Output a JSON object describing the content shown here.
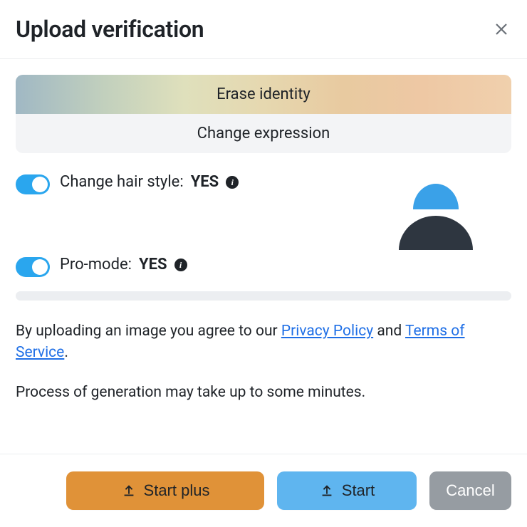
{
  "header": {
    "title": "Upload verification"
  },
  "tabs": {
    "erase": "Erase identity",
    "change": "Change expression"
  },
  "options": {
    "hair": {
      "label": "Change hair style:",
      "value": "YES"
    },
    "pro": {
      "label": "Pro-mode:",
      "value": "YES"
    }
  },
  "legal": {
    "prefix": "By uploading an image you agree to our ",
    "privacy": "Privacy Policy",
    "mid": " and ",
    "terms": "Terms of Service",
    "suffix": "."
  },
  "note": "Process of generation may take up to some minutes.",
  "footer": {
    "start_plus": "Start plus",
    "start": "Start",
    "cancel": "Cancel"
  },
  "icons": {
    "close": "close-icon",
    "upload": "upload-icon",
    "info": "info-icon",
    "avatar": "avatar-icon"
  },
  "colors": {
    "toggle_on": "#2aa6ee",
    "btn_plus": "#e09238",
    "btn_start": "#5fb5ef",
    "btn_cancel": "#969ca2",
    "link": "#1f6fe6"
  }
}
